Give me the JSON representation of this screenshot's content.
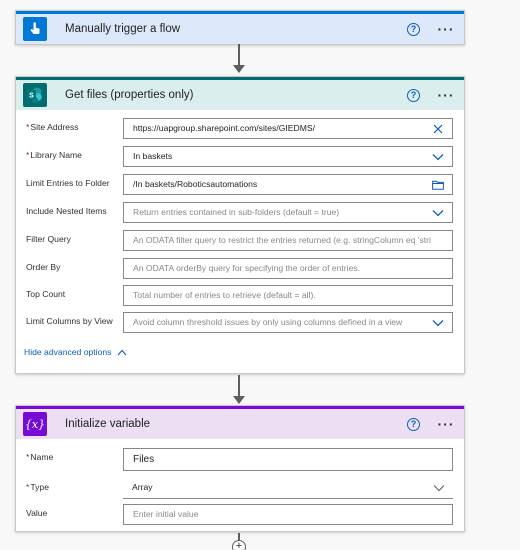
{
  "trigger": {
    "title": "Manually trigger a flow",
    "icon": "touch-hand-icon",
    "help_glyph": "?",
    "more_glyph": "···"
  },
  "get_files": {
    "title": "Get files (properties only)",
    "icon_letter": "S",
    "help_glyph": "?",
    "more_glyph": "···",
    "fields": {
      "site_address": {
        "label": "Site Address",
        "required": "*",
        "value": "https://uapgroup.sharepoint.com/sites/GIEDMS/"
      },
      "library_name": {
        "label": "Library Name",
        "required": "*",
        "value": "In baskets"
      },
      "limit_folder": {
        "label": "Limit Entries to Folder",
        "value": "/In baskets/Roboticsautomations"
      },
      "nested_items": {
        "label": "Include Nested Items",
        "placeholder": "Return entries contained in sub-folders (default = true)"
      },
      "filter_query": {
        "label": "Filter Query",
        "placeholder": "An ODATA filter query to restrict the entries returned (e.g. stringColumn eq 'stri"
      },
      "order_by": {
        "label": "Order By",
        "placeholder": "An ODATA orderBy query for specifying the order of entries."
      },
      "top_count": {
        "label": "Top Count",
        "placeholder": "Total number of entries to retrieve (default = all)."
      },
      "limit_columns": {
        "label": "Limit Columns by View",
        "placeholder": "Avoid column threshold issues by only using columns defined in a view"
      }
    },
    "advanced_link": "Hide advanced options"
  },
  "init_var": {
    "title": "Initialize variable",
    "icon_glyph": "{x}",
    "help_glyph": "?",
    "more_glyph": "···",
    "fields": {
      "name": {
        "label": "Name",
        "required": "*",
        "value": "Files"
      },
      "type": {
        "label": "Type",
        "required": "*",
        "value": "Array"
      },
      "value": {
        "label": "Value",
        "placeholder": "Enter initial value"
      }
    }
  },
  "add_step_glyph": "+",
  "colors": {
    "trigger_accent": "#0078d4",
    "sharepoint_accent": "#036c70",
    "variable_accent": "#770bd6",
    "link": "#0f5db5"
  }
}
